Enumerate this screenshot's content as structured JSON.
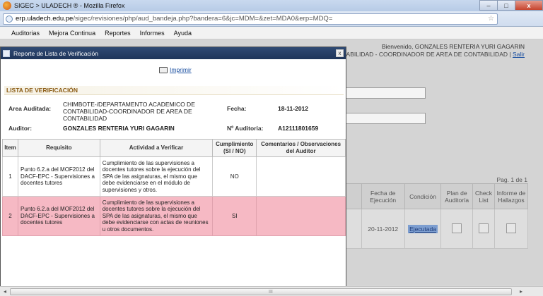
{
  "window": {
    "title": "SIGEC > ULADECH ® - Mozilla Firefox",
    "minimize": "–",
    "maximize": "□",
    "close": "x"
  },
  "browser": {
    "url_host": "erp.uladech.edu.pe",
    "url_path": "/sigec/revisiones/php/aud_bandeja.php?bandera=6&jc=MDM=&zet=MDA0&erp=MDQ="
  },
  "app_menu": [
    "Auditorias",
    "Mejora Continua",
    "Reportes",
    "Informes",
    "Ayuda"
  ],
  "background": {
    "welcome_line1": "Bienvenido, GONZALES RENTERIA YURI GAGARIN",
    "welcome_line2": "CONTABILIDAD - COORDINADOR DE AREA DE CONTABILIDAD",
    "separator": "|",
    "logout": "Salir",
    "pagination": "Pag. 1 de 1",
    "table_headers": [
      "Fecha de Ejecución",
      "Condición",
      "Plan de Auditoría",
      "Check List",
      "Informe de Hallazgos"
    ],
    "table_row": {
      "fecha": "20-11-2012",
      "condicion": "Ejecutada"
    }
  },
  "modal": {
    "title": "Reporte de Lista de Verificación",
    "close": "x",
    "print_label": "Imprimir",
    "section_title": "LISTA DE VERIFICACIÓN",
    "area_label": "Area Auditada:",
    "area_value": "CHIMBOTE-/DEPARTAMENTO ACADEMICO DE CONTABILIDAD-COORDINADOR DE AREA DE CONTABILIDAD",
    "fecha_label": "Fecha:",
    "fecha_value": "18-11-2012",
    "auditor_label": "Auditor:",
    "auditor_value": "GONZALES RENTERIA YURI GAGARIN",
    "numero_label": "Nº Auditoria:",
    "numero_value": "A12111801659",
    "table": {
      "headers": [
        "Item",
        "Requisito",
        "Actividad a Verificar",
        "Cumplimiento (SI / NO)",
        "Comentarios / Observaciones del Auditor"
      ],
      "rows": [
        {
          "item": "1",
          "requisito": "Punto 6.2.a del MOF2012 del DACF-EPC - Supervisiones a docentes tutores",
          "actividad": "Cumplimiento de las supervisiones a docentes tutores sobre la ejecución del SPA de las asignaturas, el mismo que debe evidenciarse en el módulo de supervisiones y otros.",
          "cumplimiento": "NO",
          "comentarios": ""
        },
        {
          "item": "2",
          "requisito": "Punto 6.2.a del MOF2012 del DACF-EPC - Supervisiones a docentes tutores",
          "actividad": "Cumplimiento de las supervisiones a docentes tutores sobre la ejecución del SPA de las asignaturas, el mismo que debe evidenciarse con actas de reuniones u otros documentos.",
          "cumplimiento": "SI",
          "comentarios": ""
        }
      ]
    }
  },
  "scrollbar": {
    "grip": "III",
    "left_arrow": "◂",
    "right_arrow": "▸"
  }
}
